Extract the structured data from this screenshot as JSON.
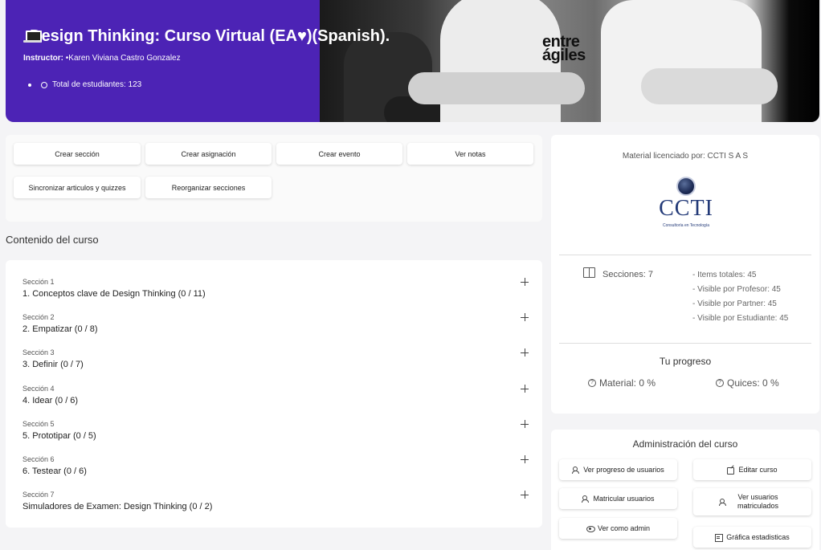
{
  "hero": {
    "title": "Design Thinking: Curso Virtual (EA♥)(Spanish).",
    "instructor_label": "Instructor:",
    "instructor_name": "•Karen Viviana Castro Gonzalez",
    "students_text": "Total de estudiantes: 123",
    "banner_logo_text": "entre ágiles"
  },
  "actions": {
    "create_section": "Crear sección",
    "create_assignment": "Crear asignación",
    "create_event": "Crear evento",
    "view_grades": "Ver notas",
    "sync_articles": "Sincronizar articulos y quizzes",
    "reorganize": "Reorganizar secciones"
  },
  "content": {
    "heading": "Contenido del curso",
    "sections": [
      {
        "number": "Sección 1",
        "title": "1. Conceptos clave de Design Thinking (0 / 11)"
      },
      {
        "number": "Sección 2",
        "title": "2. Empatizar (0 / 8)"
      },
      {
        "number": "Sección 3",
        "title": "3. Definir (0 / 7)"
      },
      {
        "number": "Sección 4",
        "title": "4. Idear (0 / 6)"
      },
      {
        "number": "Sección 5",
        "title": "5. Prototipar (0 / 5)"
      },
      {
        "number": "Sección 6",
        "title": "6. Testear (0 / 6)"
      },
      {
        "number": "Sección 7",
        "title": "Simuladores de Examen: Design Thinking (0 / 2)"
      }
    ]
  },
  "info": {
    "licensed_by": "Material licenciado por: CCTI S A S",
    "logo_text": "CCTI",
    "logo_subtitle": "Consultoría en Tecnología",
    "sections_label": "Secciones: 7",
    "stats": [
      "- Items totales: 45",
      "- Visible por Profesor: 45",
      "- Visible por Partner: 45",
      "- Visible por Estudiante: 45"
    ],
    "progress_title": "Tu progreso",
    "material_progress": "Material: 0 %",
    "quiz_progress": "Quices: 0 %"
  },
  "admin": {
    "title": "Administración del curso",
    "view_user_progress": "Ver progreso de usuarios",
    "edit_course": "Editar curso",
    "enroll_users": "Matricular usuarios",
    "view_enrolled": "Ver usuarios matriculados",
    "view_as_admin": "Ver como admin",
    "stats_chart": "Gráfica estadisticas"
  },
  "colors": {
    "hero_bg": "#4c23b5",
    "ccti_blue": "#233a78"
  },
  "icons": [
    "laptop-icon",
    "globe-icon",
    "plus-icon",
    "book-icon",
    "question-icon",
    "users-icon",
    "edit-icon",
    "user-add-icon",
    "eye-icon",
    "chart-icon"
  ]
}
